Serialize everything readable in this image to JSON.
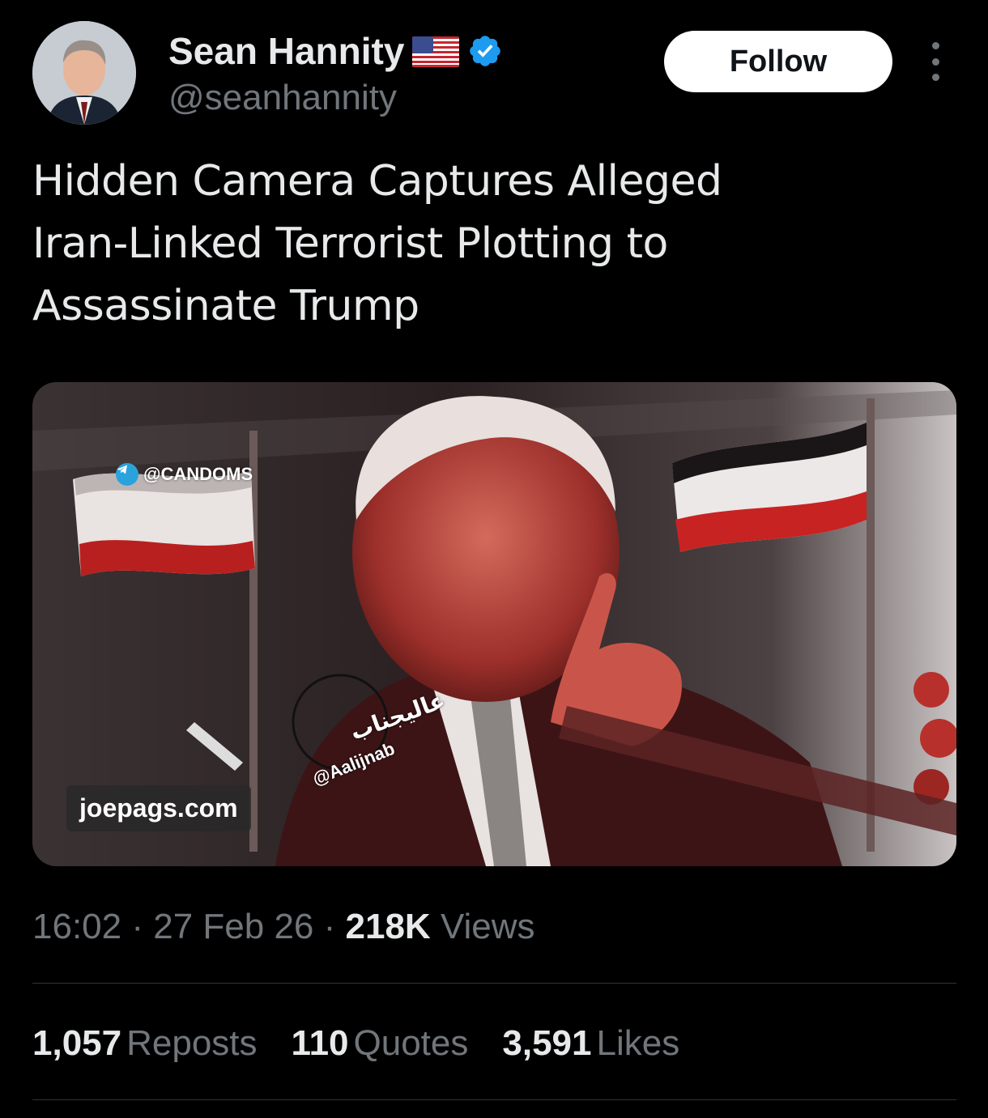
{
  "author": {
    "display_name": "Sean Hannity",
    "handle": "@seanhannity",
    "flag_icon": "us-flag-icon",
    "verified_icon": "verified-badge-icon",
    "verified_color": "#1d9bf0"
  },
  "actions": {
    "follow_label": "Follow",
    "more_icon": "more-vertical-icon"
  },
  "tweet": {
    "text_lines": [
      "Hidden Camera Captures Alleged",
      "Iran-Linked Terrorist Plotting to",
      "Assassinate Trump"
    ]
  },
  "media": {
    "watermarks": {
      "telegram": "@CANDOMS",
      "site": "joepags.com",
      "handle": "@Aalijnab",
      "arabic": "عالیجناب"
    }
  },
  "meta": {
    "time": "16:02",
    "date": "27 Feb 26",
    "views_count": "218K",
    "views_label": "Views",
    "separator": "·"
  },
  "stats": {
    "reposts_count": "1,057",
    "reposts_label": "Reposts",
    "quotes_count": "110",
    "quotes_label": "Quotes",
    "likes_count": "3,591",
    "likes_label": "Likes"
  },
  "colors": {
    "background": "#000000",
    "text_primary": "#e7e9ea",
    "text_secondary": "#71767b",
    "divider": "#2f3336",
    "follow_bg": "#ffffff"
  }
}
